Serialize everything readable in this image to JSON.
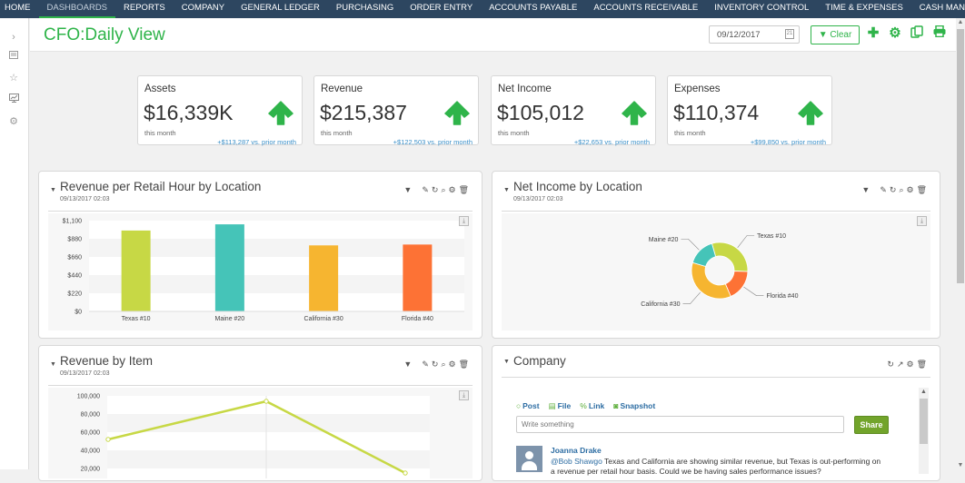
{
  "nav": {
    "items": [
      "HOME",
      "DASHBOARDS",
      "REPORTS",
      "COMPANY",
      "GENERAL LEDGER",
      "PURCHASING",
      "ORDER ENTRY",
      "ACCOUNTS PAYABLE",
      "ACCOUNTS RECEIVABLE",
      "INVENTORY CONTROL",
      "TIME & EXPENSES",
      "CASH MANAGEME"
    ],
    "active": "DASHBOARDS",
    "more_label": ">"
  },
  "sidebar": {
    "icons": [
      "chevron-right-icon",
      "list-icon",
      "star-icon",
      "monitor-chart-icon",
      "gear-icon"
    ]
  },
  "header": {
    "title": "CFO:Daily View",
    "date_value": "09/12/2017",
    "clear_label": "Clear",
    "actions": [
      "add-icon",
      "gear-icon",
      "copy-icon",
      "print-icon"
    ]
  },
  "kpis": [
    {
      "label": "Assets",
      "value": "$16,339K",
      "sub": "this month",
      "delta": "+$113,287 vs. prior month",
      "trend": "up"
    },
    {
      "label": "Revenue",
      "value": "$215,387",
      "sub": "this month",
      "delta": "+$122,503 vs. prior month",
      "trend": "up"
    },
    {
      "label": "Net Income",
      "value": "$105,012",
      "sub": "this month",
      "delta": "+$22,653 vs. prior month",
      "trend": "up"
    },
    {
      "label": "Expenses",
      "value": "$110,374",
      "sub": "this month",
      "delta": "+$99,850 vs. prior month",
      "trend": "up"
    }
  ],
  "colors": {
    "accent": "#2fb44a",
    "nav_bg": "#2d4660",
    "link": "#3a8fc8",
    "texas": "#c7d845",
    "maine": "#45c4b8",
    "california": "#f6b530",
    "florida": "#fd7235",
    "line": "#c7d845",
    "share": "#72a42b"
  },
  "panels": {
    "rev_retail": {
      "title": "Revenue per Retail Hour by Location",
      "timestamp": "09/13/2017 02:03"
    },
    "net_income": {
      "title": "Net Income by Location",
      "timestamp": "09/13/2017 02:03"
    },
    "rev_item": {
      "title": "Revenue by Item",
      "timestamp": "09/13/2017 02:03"
    },
    "company": {
      "title": "Company",
      "tabs": [
        "Post",
        "File",
        "Link",
        "Snapshot"
      ],
      "post_placeholder": "Write something",
      "share_label": "Share",
      "feed": [
        {
          "author": "Joanna Drake",
          "mention": "@Bob Shawgo",
          "text": " Texas and California are showing similar revenue, but Texas is out-performing on a revenue per retail hour basis. Could we be having sales performance issues?"
        }
      ]
    }
  },
  "chart_data": [
    {
      "type": "bar",
      "title": "Revenue per Retail Hour by Location",
      "categories": [
        "Texas #10",
        "Maine #20",
        "California #30",
        "Florida #40"
      ],
      "values": [
        980,
        1055,
        800,
        810
      ],
      "yticks": [
        "$0",
        "$220",
        "$440",
        "$660",
        "$880",
        "$1,100"
      ],
      "ylim": [
        0,
        1100
      ],
      "xlabel": "",
      "ylabel": "",
      "grid": true
    },
    {
      "type": "pie",
      "title": "Net Income by Location",
      "donut": true,
      "labels": [
        "Texas #10",
        "Florida #40",
        "California #30",
        "Maine #20"
      ],
      "values": [
        30,
        18,
        36,
        16
      ]
    },
    {
      "type": "line",
      "title": "Revenue by Item",
      "x": [
        1,
        2,
        3
      ],
      "values": [
        52000,
        94000,
        15000
      ],
      "yticks": [
        "20,000",
        "40,000",
        "60,000",
        "80,000",
        "100,000"
      ],
      "ylim": [
        0,
        100000
      ],
      "grid": true
    }
  ]
}
